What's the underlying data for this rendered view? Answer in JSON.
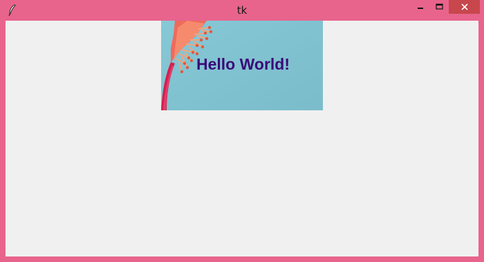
{
  "window": {
    "title": "tk",
    "icon": "feather-icon",
    "controls": [
      "minimize-icon",
      "maximize-icon",
      "close-icon"
    ],
    "frame_color": "#e8648d",
    "close_color": "#c7474c"
  },
  "client": {
    "background": "#f0f0f0",
    "label": {
      "text": "Hello World!",
      "text_color": "#3a0a78",
      "image": "pink-flower-on-teal-background",
      "image_background": "#82c4d1"
    }
  }
}
